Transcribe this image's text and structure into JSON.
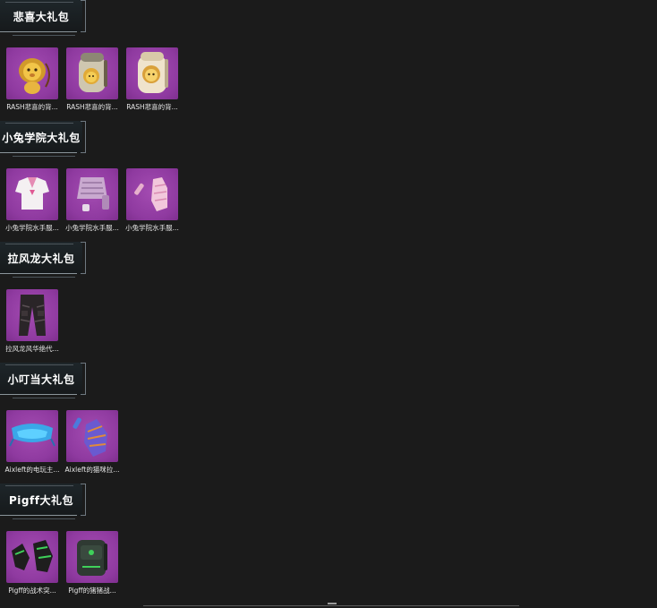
{
  "sections": [
    {
      "title": "悲喜大礼包",
      "items": [
        {
          "label": "RASH悲喜的背...",
          "icon": "lion-plush-icon"
        },
        {
          "label": "RASH悲喜的背...",
          "icon": "lion-backpack-icon"
        },
        {
          "label": "RASH悲喜的背...",
          "icon": "lion-backpack-cream-icon"
        }
      ]
    },
    {
      "title": "小兔学院大礼包",
      "items": [
        {
          "label": "小兔学院水手服...",
          "icon": "sailor-shirt-icon"
        },
        {
          "label": "小兔学院水手服...",
          "icon": "sailor-skirt-icon"
        },
        {
          "label": "小兔学院水手服...",
          "icon": "glove-pink-icon"
        }
      ]
    },
    {
      "title": "拉风龙大礼包",
      "items": [
        {
          "label": "拉风龙风华绝代...",
          "icon": "pants-icon"
        }
      ]
    },
    {
      "title": "小叮当大礼包",
      "items": [
        {
          "label": "Aixleft的电玩主...",
          "icon": "visor-icon"
        },
        {
          "label": "Aixleft的猫咪拉...",
          "icon": "glove-purple-icon"
        }
      ]
    },
    {
      "title": "Pigff大礼包",
      "items": [
        {
          "label": "Pigff的战术突...",
          "icon": "glove-green-icon"
        },
        {
          "label": "Pigff的猪猪战...",
          "icon": "backpack-dark-icon"
        }
      ]
    }
  ],
  "colors": {
    "background": "#1b1b1b",
    "item_bg": "#9a44ab",
    "header_bg": "#1e262a",
    "text": "#ffffff"
  }
}
